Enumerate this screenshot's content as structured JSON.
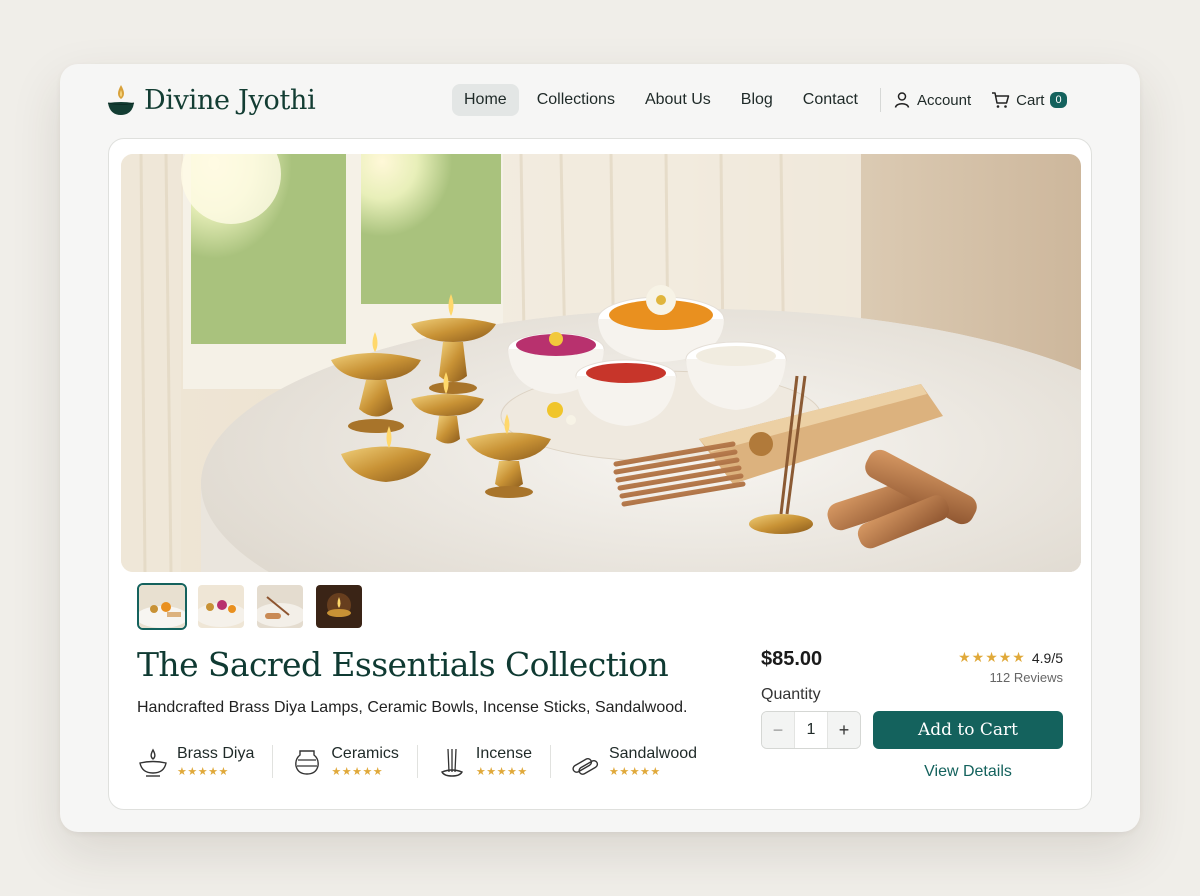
{
  "brand": {
    "name": "Divine Jyothi",
    "logo_icon": "diya-lamp-icon"
  },
  "nav": {
    "items": [
      {
        "label": "Home",
        "active": true
      },
      {
        "label": "Collections",
        "active": false
      },
      {
        "label": "About Us",
        "active": false
      },
      {
        "label": "Blog",
        "active": false
      },
      {
        "label": "Contact",
        "active": false
      }
    ],
    "account_label": "Account",
    "cart_label": "Cart",
    "cart_count": "0"
  },
  "product": {
    "title": "The Sacred Essentials Collection",
    "subtitle": "Handcrafted Brass Diya Lamps, Ceramic Bowls, Incense Sticks, Sandalwood.",
    "features": [
      {
        "name": "Brass Diya",
        "icon": "diya-icon",
        "stars": "★★★★★"
      },
      {
        "name": "Ceramics",
        "icon": "pot-icon",
        "stars": "★★★★★"
      },
      {
        "name": "Incense",
        "icon": "incense-icon",
        "stars": "★★★★★"
      },
      {
        "name": "Sandalwood",
        "icon": "sandalwood-icon",
        "stars": "★★★★★"
      }
    ],
    "price": "$85.00",
    "rating_stars": "★★★★★",
    "rating_score": "4.9/5",
    "rating_count": "112 Reviews",
    "quantity_label": "Quantity",
    "quantity_value": "1",
    "minus_symbol": "−",
    "plus_symbol": "+",
    "add_to_cart_label": "Add to Cart",
    "view_details_label": "View Details",
    "thumbnail_count": 4,
    "active_thumbnail": 1
  },
  "colors": {
    "brand": "#133d33",
    "accent": "#14625d",
    "star": "#e0a93a",
    "background": "#f0eee9"
  }
}
